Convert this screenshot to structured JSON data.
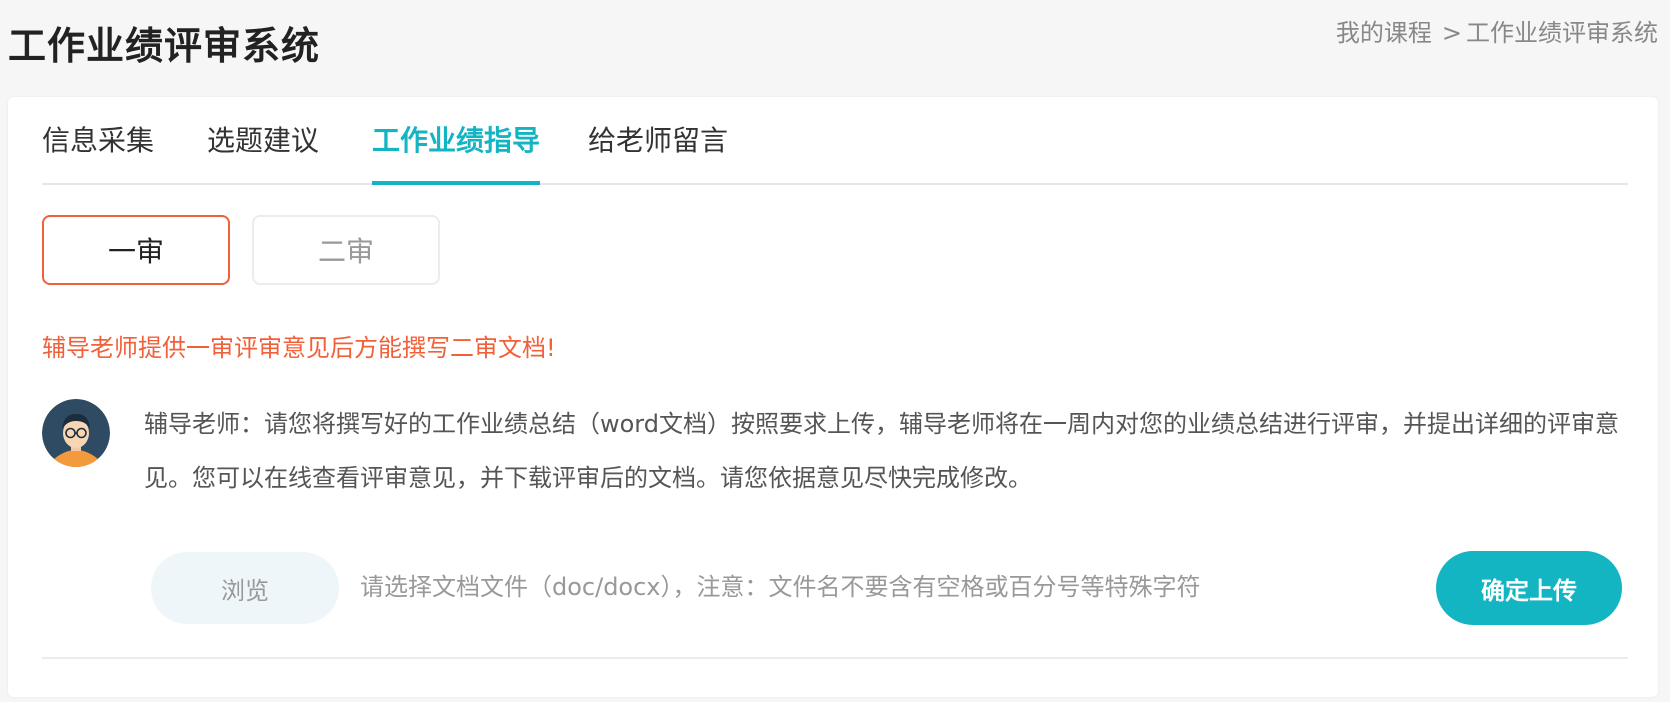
{
  "header": {
    "title": "工作业绩评审系统",
    "breadcrumb": {
      "home": "我的课程",
      "separator": ">",
      "current": "工作业绩评审系统"
    }
  },
  "tabs": [
    {
      "label": "信息采集",
      "active": false
    },
    {
      "label": "选题建议",
      "active": false
    },
    {
      "label": "工作业绩指导",
      "active": true
    },
    {
      "label": "给老师留言",
      "active": false
    }
  ],
  "review_stages": [
    {
      "label": "一审",
      "active": true
    },
    {
      "label": "二审",
      "active": false
    }
  ],
  "warning": "辅导老师提供一审评审意见后方能撰写二审文档!",
  "instruction": {
    "avatar_icon": "teacher-avatar-icon",
    "text": "辅导老师：请您将撰写好的工作业绩总结（word文档）按照要求上传，辅导老师将在一周内对您的业绩总结进行评审，并提出详细的评审意见。您可以在线查看评审意见，并下载评审后的文档。请您依据意见尽快完成修改。"
  },
  "upload": {
    "browse_label": "浏览",
    "file_hint": "请选择文档文件（doc/docx），注意：文件名不要含有空格或百分号等特殊字符",
    "submit_label": "确定上传"
  },
  "colors": {
    "accent": "#13b5c3",
    "warning": "#f2603a",
    "browse_bg": "#eef6f9",
    "page_bg": "#f6f6f6"
  }
}
